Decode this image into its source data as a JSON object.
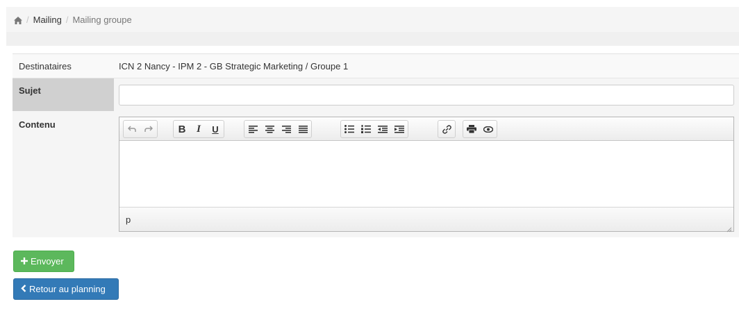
{
  "breadcrumb": {
    "home_icon": "home-icon",
    "items": [
      {
        "label": "Mailing",
        "active": false
      },
      {
        "label": "Mailing groupe",
        "active": true
      }
    ],
    "separator": "/"
  },
  "form": {
    "destinataires": {
      "label": "Destinataires",
      "value": "ICN 2 Nancy - IPM 2 - GB Strategic Marketing / Groupe 1"
    },
    "sujet": {
      "label": "Sujet",
      "value": "",
      "placeholder": ""
    },
    "contenu": {
      "label": "Contenu"
    }
  },
  "editor": {
    "toolbar_groups": [
      [
        "undo-icon",
        "redo-icon"
      ],
      [
        "bold-icon",
        "italic-icon",
        "underline-icon"
      ],
      [
        "align-left-icon",
        "align-center-icon",
        "align-right-icon",
        "align-justify-icon"
      ],
      [
        "bullet-list-icon",
        "numbered-list-icon",
        "outdent-icon",
        "indent-icon"
      ],
      [
        "link-icon"
      ],
      [
        "print-icon",
        "preview-icon"
      ]
    ],
    "status_path": "p"
  },
  "actions": {
    "send_label": "Envoyer",
    "send_icon": "plus-icon",
    "back_label": "Retour au planning",
    "back_icon": "chevron-left-icon"
  },
  "colors": {
    "send": "#5cb85c",
    "back": "#337ab7",
    "sujet_label_bg": "#d0d0d0"
  }
}
